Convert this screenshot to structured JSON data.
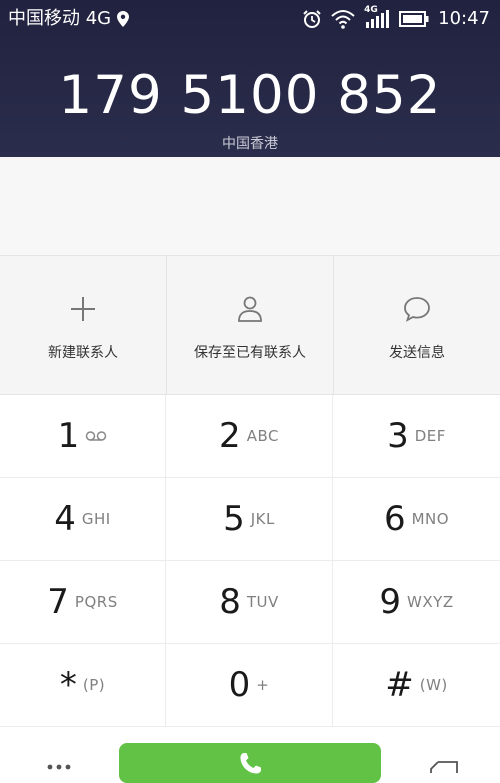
{
  "status_bar": {
    "carrier": "中国移动 4G",
    "signal_network_label": "4G",
    "time": "10:47"
  },
  "dialer": {
    "number": "179 5100 852",
    "region": "中国香港"
  },
  "actions": [
    {
      "label": "新建联系人",
      "icon": "plus-icon"
    },
    {
      "label": "保存至已有联系人",
      "icon": "person-icon"
    },
    {
      "label": "发送信息",
      "icon": "message-bubble-icon"
    }
  ],
  "keypad": [
    {
      "digit": "1",
      "letters": "",
      "icon": "voicemail-icon"
    },
    {
      "digit": "2",
      "letters": "ABC"
    },
    {
      "digit": "3",
      "letters": "DEF"
    },
    {
      "digit": "4",
      "letters": "GHI"
    },
    {
      "digit": "5",
      "letters": "JKL"
    },
    {
      "digit": "6",
      "letters": "MNO"
    },
    {
      "digit": "7",
      "letters": "PQRS"
    },
    {
      "digit": "8",
      "letters": "TUV"
    },
    {
      "digit": "9",
      "letters": "WXYZ"
    },
    {
      "digit": "*",
      "letters": "(P)"
    },
    {
      "digit": "0",
      "letters": "+"
    },
    {
      "digit": "#",
      "letters": "(W)"
    }
  ],
  "colors": {
    "header_bg": "#20223f",
    "call_button": "#62c246",
    "action_row_bg": "#f6f5f6"
  }
}
